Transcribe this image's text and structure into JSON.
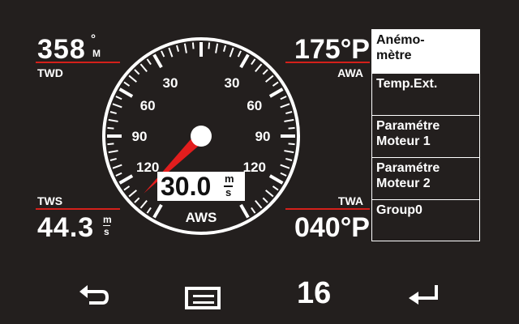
{
  "top_left": {
    "value": "358",
    "unit_top": "°",
    "unit_bottom": "M",
    "label": "TWD"
  },
  "top_right": {
    "value": "175°P",
    "label": "AWA"
  },
  "bottom_left": {
    "label": "TWS",
    "value": "44.3",
    "unit_top": "m",
    "unit_bottom": "s"
  },
  "bottom_right": {
    "label": "TWA",
    "value": "040°P"
  },
  "gauge": {
    "label": "AWS",
    "readout": "30.0",
    "readout_unit_top": "m",
    "readout_unit_bottom": "s",
    "scale_labels": [
      "30",
      "60",
      "90",
      "120",
      "30",
      "60",
      "90",
      "120"
    ],
    "needle_angle_deg": 225,
    "colors": {
      "needle": "#e21d1d",
      "face": "#231f1e",
      "ticks": "#ffffff"
    }
  },
  "menu": {
    "items": [
      {
        "line1": "Anémo-",
        "line2": "mètre",
        "selected": true
      },
      {
        "line1": "Temp.Ext.",
        "line2": "",
        "selected": false
      },
      {
        "line1": "Paramétre",
        "line2": "Moteur 1",
        "selected": false
      },
      {
        "line1": "Paramétre",
        "line2": "Moteur 2",
        "selected": false
      },
      {
        "line1": "Group0",
        "line2": "",
        "selected": false
      }
    ]
  },
  "bottom_bar": {
    "back_icon": "return-arrow-icon",
    "menu_icon": "menu-icon",
    "page_number": "16",
    "enter_icon": "enter-arrow-icon"
  },
  "colors": {
    "background": "#231f1e",
    "accent_red": "#d4201a",
    "text": "#ffffff"
  }
}
